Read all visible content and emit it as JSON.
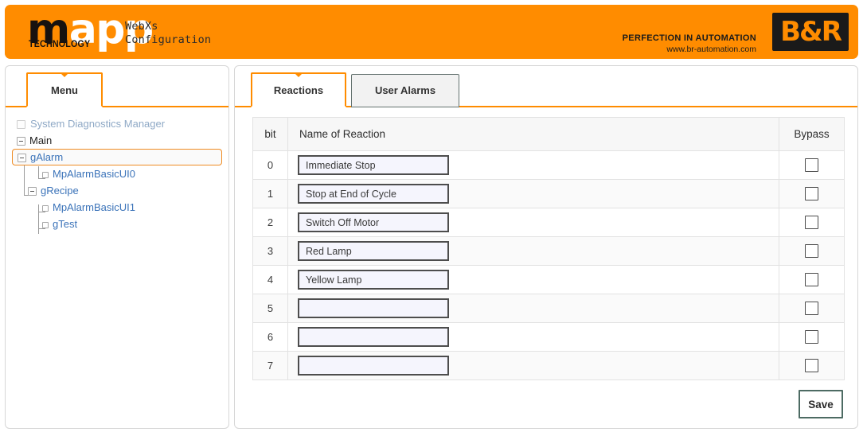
{
  "header": {
    "logo_m": "m",
    "logo_app": "app",
    "logo_technology": "TECHNOLOGY",
    "title_line1": "WebXs",
    "title_line2": "Configuration",
    "slogan": "PERFECTION IN AUTOMATION",
    "website": "www.br-automation.com",
    "brand_logo_text": "B&R",
    "accent_color": "#ff8c00"
  },
  "sidebar": {
    "tab_label": "Menu",
    "tree": [
      {
        "label": "System Diagnostics Manager",
        "node": "dim-box",
        "indent": 0,
        "selected": false,
        "style": "dim"
      },
      {
        "label": "Main",
        "node": "minus",
        "indent": 0,
        "selected": false,
        "style": "dark"
      },
      {
        "label": "gAlarm",
        "node": "minus",
        "indent": 1,
        "selected": true,
        "style": "link"
      },
      {
        "label": "MpAlarmBasicUI0",
        "node": "leaf",
        "indent": 2,
        "selected": false,
        "style": "link"
      },
      {
        "label": "gRecipe",
        "node": "minus",
        "indent": 1,
        "selected": false,
        "style": "link"
      },
      {
        "label": "MpAlarmBasicUI1",
        "node": "leaf",
        "indent": 2,
        "selected": false,
        "style": "link"
      },
      {
        "label": "gTest",
        "node": "leaf",
        "indent": 2,
        "selected": false,
        "style": "link"
      }
    ]
  },
  "main": {
    "tabs": [
      {
        "label": "Reactions",
        "active": true
      },
      {
        "label": "User Alarms",
        "active": false
      }
    ],
    "table": {
      "columns": [
        "bit",
        "Name of Reaction",
        "Bypass"
      ],
      "rows": [
        {
          "bit": "0",
          "reaction": "Immediate Stop",
          "bypass": false
        },
        {
          "bit": "1",
          "reaction": "Stop at End of Cycle",
          "bypass": false
        },
        {
          "bit": "2",
          "reaction": "Switch Off Motor",
          "bypass": false
        },
        {
          "bit": "3",
          "reaction": "Red Lamp",
          "bypass": false
        },
        {
          "bit": "4",
          "reaction": "Yellow Lamp",
          "bypass": false
        },
        {
          "bit": "5",
          "reaction": "",
          "bypass": false
        },
        {
          "bit": "6",
          "reaction": "",
          "bypass": false
        },
        {
          "bit": "7",
          "reaction": "",
          "bypass": false
        }
      ]
    },
    "save_label": "Save"
  }
}
